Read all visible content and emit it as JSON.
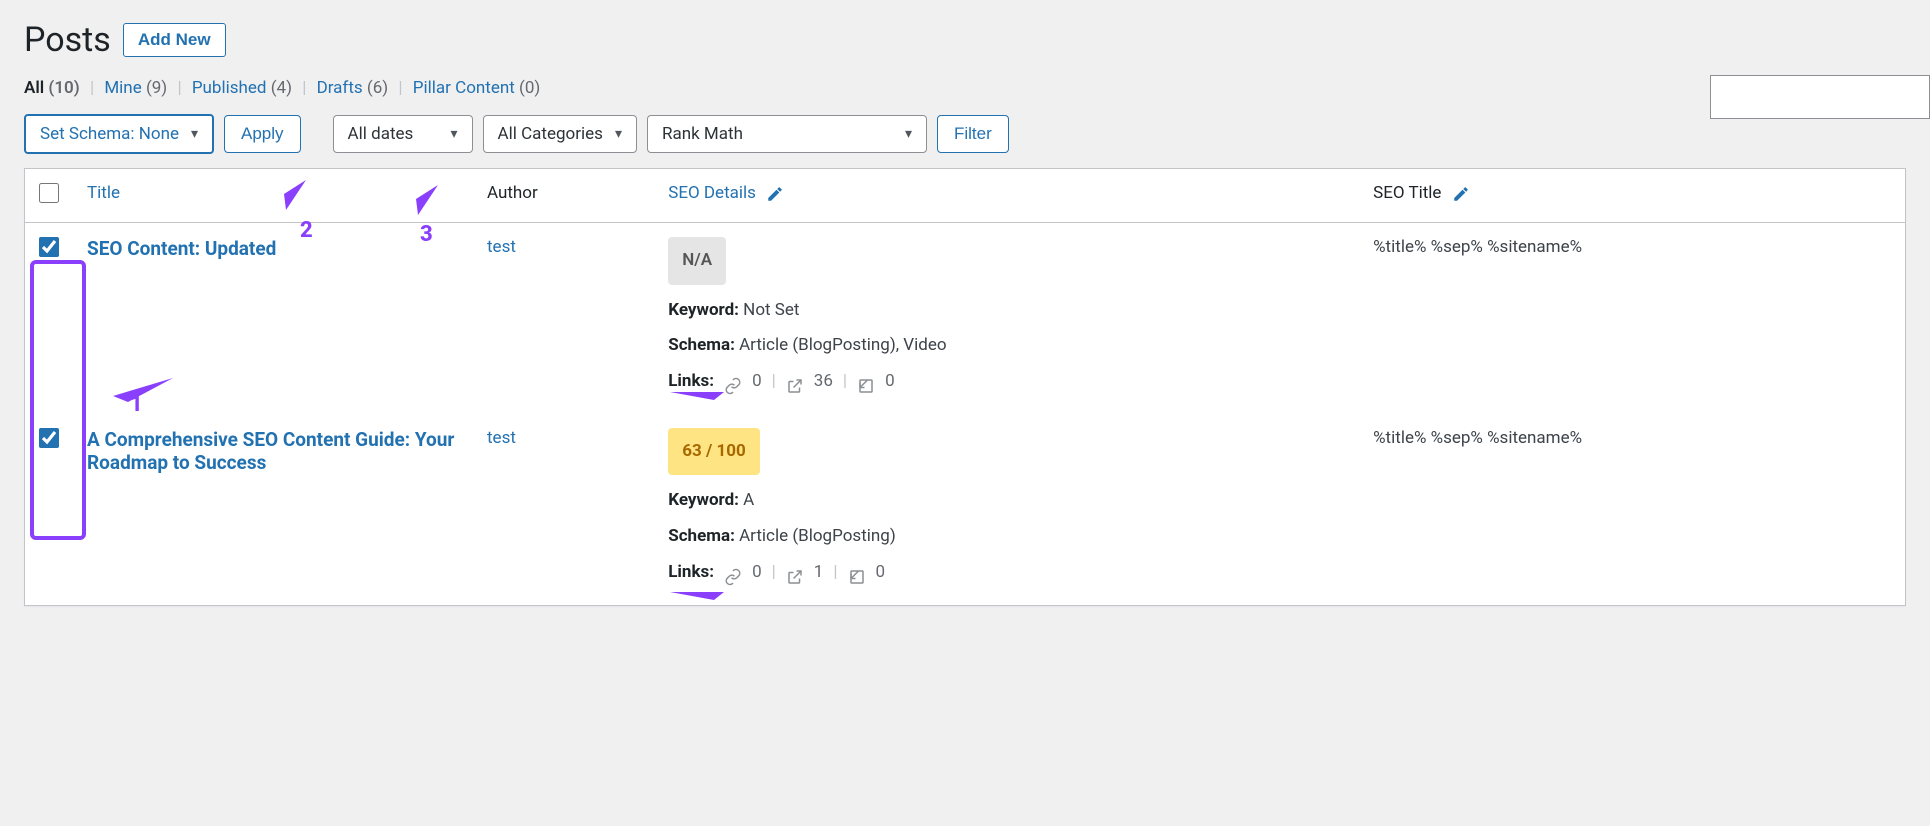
{
  "header": {
    "title": "Posts",
    "add_new": "Add New"
  },
  "filters": {
    "all_label": "All",
    "all_count": "(10)",
    "mine_label": "Mine",
    "mine_count": "(9)",
    "published_label": "Published",
    "published_count": "(4)",
    "drafts_label": "Drafts",
    "drafts_count": "(6)",
    "pillar_label": "Pillar Content",
    "pillar_count": "(0)"
  },
  "actions": {
    "bulk_action": "Set Schema: None",
    "apply": "Apply",
    "dates": "All dates",
    "categories": "All Categories",
    "rank_filter": "Rank Math",
    "filter": "Filter"
  },
  "columns": {
    "title": "Title",
    "author": "Author",
    "seo_details": "SEO Details",
    "seo_title": "SEO Title"
  },
  "rows": [
    {
      "checked": true,
      "title": "SEO Content: Updated",
      "author": "test",
      "score": "N/A",
      "score_type": "na",
      "keyword_label": "Keyword:",
      "keyword": "Not Set",
      "schema_label": "Schema:",
      "schema": "Article (BlogPosting), Video",
      "links_label": "Links:",
      "links_internal": "0",
      "links_external": "36",
      "links_incoming": "0",
      "seo_title": "%title% %sep% %sitename%"
    },
    {
      "checked": true,
      "title": "A Comprehensive SEO Content Guide: Your Roadmap to Success",
      "author": "test",
      "score": "63 / 100",
      "score_type": "score",
      "keyword_label": "Keyword:",
      "keyword": "A",
      "schema_label": "Schema:",
      "schema": "Article (BlogPosting)",
      "links_label": "Links:",
      "links_internal": "0",
      "links_external": "1",
      "links_incoming": "0",
      "seo_title": "%title% %sep% %sitename%"
    }
  ],
  "annotations": {
    "n1": "1",
    "n2": "2",
    "n3": "3"
  }
}
